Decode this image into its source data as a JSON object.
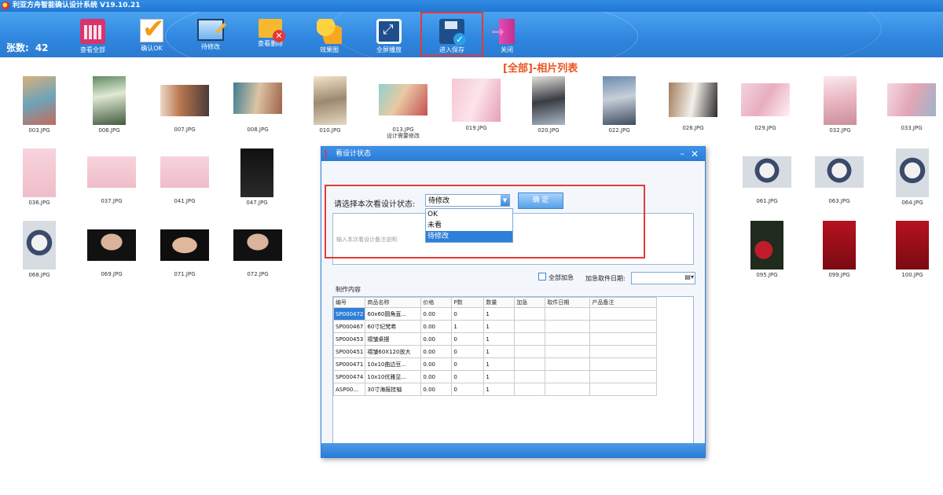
{
  "app": {
    "title": "利亚方舟智能确认设计系统 V19.10.21"
  },
  "toolbar": {
    "count_label": "张数:",
    "count_value": "42",
    "buttons": [
      {
        "label": "查看全部",
        "icon": "calendar-grid-icon"
      },
      {
        "label": "确认OK",
        "icon": "checkmark-icon"
      },
      {
        "label": "待修改",
        "icon": "edit-monitor-icon"
      },
      {
        "label": "查看删除",
        "icon": "folder-delete-icon"
      },
      {
        "label": "效果图",
        "icon": "puzzle-icon"
      },
      {
        "label": "全屏播放",
        "icon": "fullscreen-icon"
      },
      {
        "label": "进入保存",
        "icon": "save-icon"
      },
      {
        "label": "关闭",
        "icon": "exit-icon"
      }
    ]
  },
  "list_title": "[全部]-相片列表",
  "photos": [
    {
      "name": "003.JPG",
      "note": ""
    },
    {
      "name": "006.JPG",
      "note": ""
    },
    {
      "name": "007.JPG",
      "note": ""
    },
    {
      "name": "008.JPG",
      "note": ""
    },
    {
      "name": "010.JPG",
      "note": ""
    },
    {
      "name": "013.JPG",
      "note": "设计需要修改"
    },
    {
      "name": "019.JPG",
      "note": ""
    },
    {
      "name": "020.JPG",
      "note": ""
    },
    {
      "name": "022.JPG",
      "note": ""
    },
    {
      "name": "026.JPG",
      "note": ""
    },
    {
      "name": "029.JPG",
      "note": ""
    },
    {
      "name": "032.JPG",
      "note": ""
    },
    {
      "name": "033.JPG",
      "note": ""
    },
    {
      "name": "036.JPG",
      "note": ""
    },
    {
      "name": "037.JPG",
      "note": ""
    },
    {
      "name": "041.JPG",
      "note": ""
    },
    {
      "name": "047.JPG",
      "note": ""
    },
    {
      "name": "061.JPG",
      "note": ""
    },
    {
      "name": "063.JPG",
      "note": ""
    },
    {
      "name": "064.JPG",
      "note": ""
    },
    {
      "name": "068.JPG",
      "note": ""
    },
    {
      "name": "069.JPG",
      "note": ""
    },
    {
      "name": "071.JPG",
      "note": ""
    },
    {
      "name": "072.JPG",
      "note": ""
    },
    {
      "name": "095.JPG",
      "note": ""
    },
    {
      "name": "099.JPG",
      "note": ""
    },
    {
      "name": "100.JPG",
      "note": ""
    }
  ],
  "dialog": {
    "title": "看设计状态",
    "state_label": "请选择本次看设计状态:",
    "selected_state": "待修改",
    "options": [
      "OK",
      "未看",
      "待修改"
    ],
    "confirm_label": "确 定",
    "notes_placeholder": "输入本次看设计备注说明",
    "urgent_label": "全部加急",
    "urgent_date_label": "加急取件日期:",
    "section_label": "制作内容",
    "table": {
      "headers": [
        "编号",
        "商品名称",
        "价格",
        "P数",
        "数量",
        "加急",
        "取件日期",
        "产品备注"
      ],
      "rows": [
        [
          "SP000472",
          "60x60圆角直...",
          "0.00",
          "0",
          "1",
          "",
          "",
          ""
        ],
        [
          "SP000467",
          "60寸纪梵希",
          "0.00",
          "1",
          "1",
          "",
          "",
          ""
        ],
        [
          "SP000453",
          "褶皱桌摆",
          "0.00",
          "0",
          "1",
          "",
          "",
          ""
        ],
        [
          "SP000451",
          "褶皱60X120放大",
          "0.00",
          "0",
          "1",
          "",
          "",
          ""
        ],
        [
          "SP000471",
          "10x10曲边豆...",
          "0.00",
          "0",
          "1",
          "",
          "",
          ""
        ],
        [
          "SP000474",
          "10x10优雅显...",
          "0.00",
          "0",
          "1",
          "",
          "",
          ""
        ],
        [
          "ASP00...",
          "30寸海报挂轴",
          "0.00",
          "0",
          "1",
          "",
          "",
          ""
        ]
      ]
    }
  }
}
